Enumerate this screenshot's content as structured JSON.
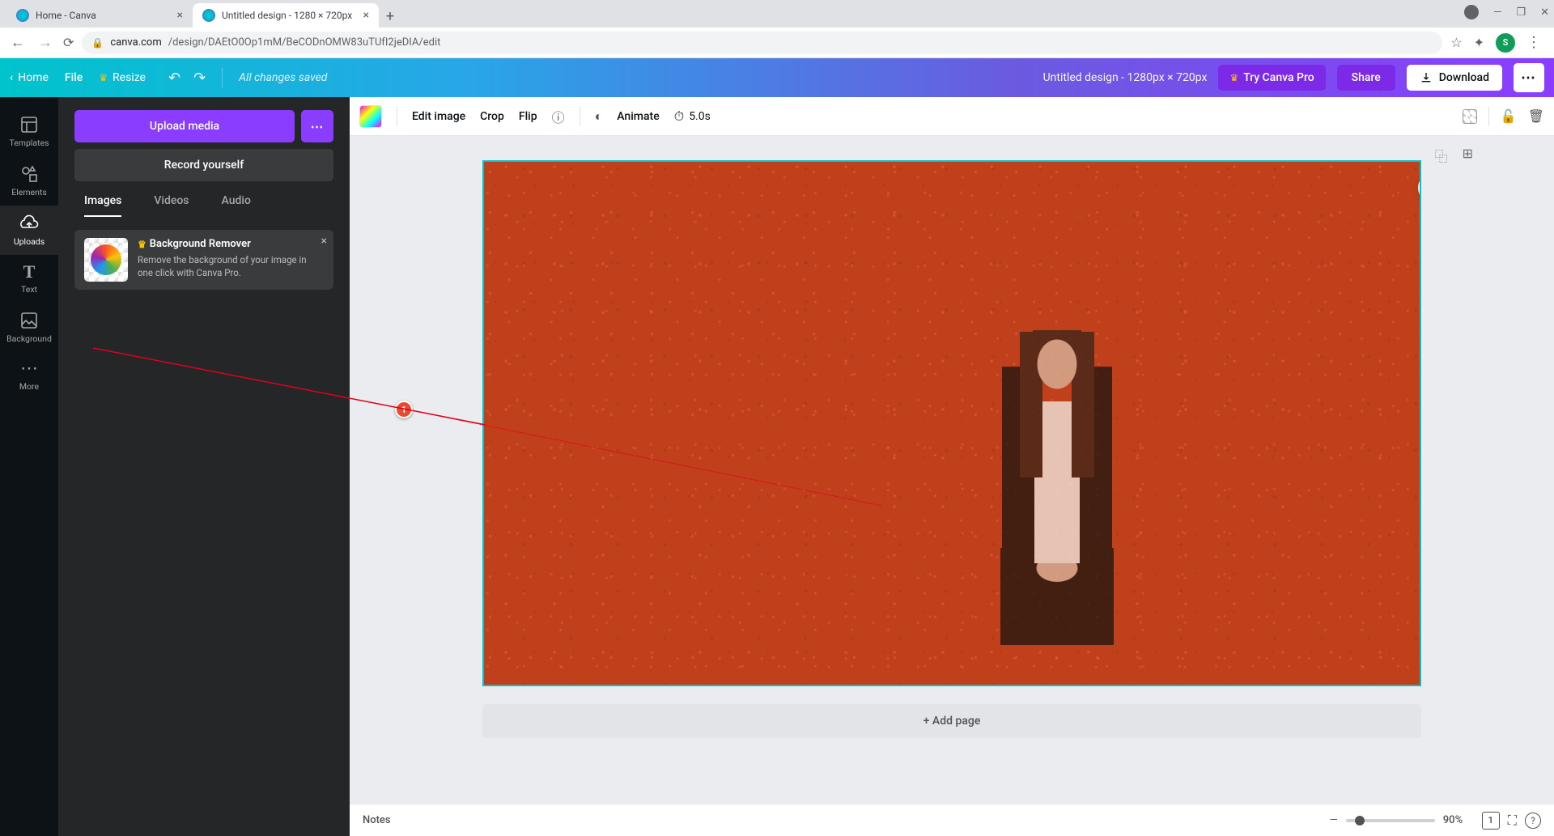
{
  "browser": {
    "tabs": [
      {
        "title": "Home - Canva",
        "active": false
      },
      {
        "title": "Untitled design - 1280 × 720px",
        "active": true
      }
    ],
    "url_host": "canva.com",
    "url_path": "/design/DAEtO0Op1mM/BeCODnOMW83uTUfI2jeDIA/edit",
    "avatar_initial": "S"
  },
  "topbar": {
    "home": "Home",
    "file": "File",
    "resize": "Resize",
    "saved": "All changes saved",
    "doc_title": "Untitled design - 1280px × 720px",
    "try_pro": "Try Canva Pro",
    "share": "Share",
    "download": "Download"
  },
  "rail": {
    "items": [
      {
        "id": "templates",
        "label": "Templates"
      },
      {
        "id": "elements",
        "label": "Elements"
      },
      {
        "id": "uploads",
        "label": "Uploads"
      },
      {
        "id": "text",
        "label": "Text"
      },
      {
        "id": "background",
        "label": "Background"
      },
      {
        "id": "more",
        "label": "More"
      }
    ],
    "active": "uploads"
  },
  "sidepanel": {
    "upload_btn": "Upload media",
    "record_btn": "Record yourself",
    "tabs": {
      "images": "Images",
      "videos": "Videos",
      "audio": "Audio"
    },
    "active_tab": "images",
    "promo": {
      "title": "Background Remover",
      "desc": "Remove the background of your image in one click with Canva Pro."
    }
  },
  "context": {
    "edit_image": "Edit image",
    "crop": "Crop",
    "flip": "Flip",
    "animate": "Animate",
    "timing": "5.0s"
  },
  "stage": {
    "add_page": "+ Add page"
  },
  "bottom": {
    "notes": "Notes",
    "zoom": "90%",
    "page_count": "1"
  },
  "annotation": {
    "badge": "1"
  }
}
